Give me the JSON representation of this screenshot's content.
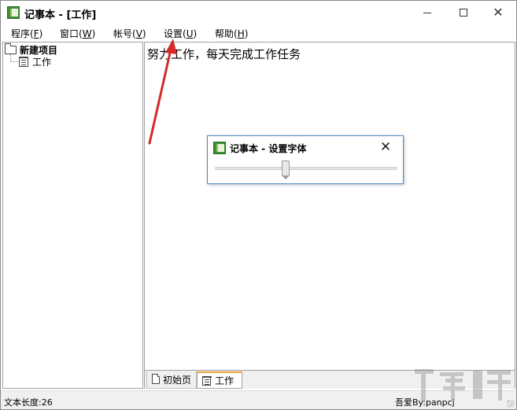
{
  "window": {
    "title": "记事本 - [工作]"
  },
  "menu": {
    "items": [
      {
        "label": "程序(",
        "key": "F",
        "suffix": ")"
      },
      {
        "label": "窗口(",
        "key": "W",
        "suffix": ")"
      },
      {
        "label": "帐号(",
        "key": "V",
        "suffix": ")"
      },
      {
        "label": "设置(",
        "key": "U",
        "suffix": ")"
      },
      {
        "label": "帮助(",
        "key": "H",
        "suffix": ")"
      }
    ]
  },
  "tree": {
    "root_label": "新建项目",
    "child_label": "工作"
  },
  "editor": {
    "content": "努力工作，每天完成工作任务"
  },
  "tabs": [
    {
      "label": "初始页",
      "icon": "folder-icon"
    },
    {
      "label": "工作",
      "icon": "note-icon",
      "active": true
    }
  ],
  "status": {
    "left": "文本长度:26",
    "right": "吾爱By:panpcj"
  },
  "dialog": {
    "title": "记事本 - 设置字体",
    "slider_value": 0.39
  },
  "colors": {
    "accent_tab": "#e8a33a",
    "dialog_border": "#4a88c7",
    "arrow": "#d42a2a",
    "app_icon": "#3f8f3a"
  }
}
